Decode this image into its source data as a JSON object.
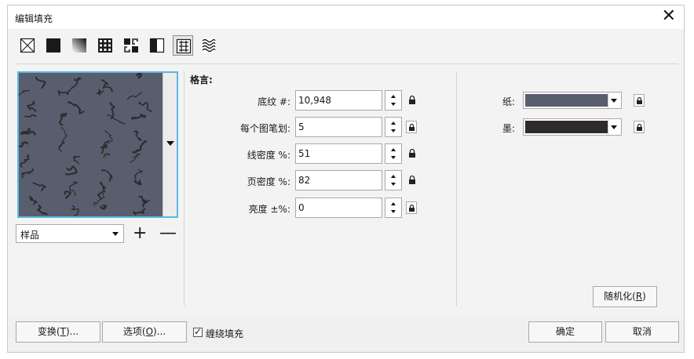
{
  "window": {
    "title": "编辑填充"
  },
  "toolbar": {
    "buttons": [
      {
        "name": "no-fill",
        "icon": "no-fill-icon"
      },
      {
        "name": "uniform-fill",
        "icon": "uniform-fill-icon"
      },
      {
        "name": "fountain-fill",
        "icon": "fountain-fill-icon"
      },
      {
        "name": "vector-pattern-fill",
        "icon": "vector-pattern-icon"
      },
      {
        "name": "bitmap-pattern-fill",
        "icon": "bitmap-pattern-icon"
      },
      {
        "name": "two-color-pattern-fill",
        "icon": "two-color-pattern-icon"
      },
      {
        "name": "texture-fill",
        "icon": "texture-fill-icon",
        "selected": true
      },
      {
        "name": "postscript-fill",
        "icon": "postscript-fill-icon"
      }
    ]
  },
  "library": {
    "select_value": "样品",
    "add_label": "+",
    "remove_label": "—"
  },
  "texture": {
    "section_title": "格言:",
    "fields": [
      {
        "label": "底纹 #:",
        "value": "10,948"
      },
      {
        "label": "每个图笔划:",
        "value": "5"
      },
      {
        "label": "线密度 %:",
        "value": "51"
      },
      {
        "label": "页密度 %:",
        "value": "82"
      },
      {
        "label": "亮度 ±%:",
        "value": "0"
      }
    ]
  },
  "colors": {
    "paper": {
      "label": "纸:",
      "color": "#585e6e"
    },
    "ink": {
      "label": "墨:",
      "color": "#2f2a2b"
    }
  },
  "buttons": {
    "randomize": {
      "text": "随机化",
      "key": "R"
    },
    "transform": {
      "text": "变换",
      "key": "T"
    },
    "options": {
      "text": "选项",
      "key": "O"
    },
    "ok": "确定",
    "cancel": "取消"
  },
  "wrap_fill": {
    "label": "缠绕填充",
    "checked": true
  }
}
